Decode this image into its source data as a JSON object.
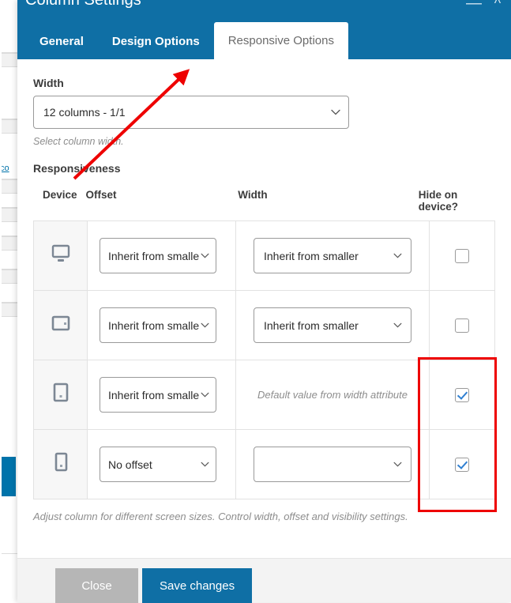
{
  "window": {
    "title": "Column Settings",
    "minimize_label": "—",
    "collapse_label": "^",
    "accent_color": "#0f6fa5",
    "annotation_color": "#ee0000"
  },
  "tabs": [
    {
      "label": "General",
      "active": false
    },
    {
      "label": "Design Options",
      "active": false
    },
    {
      "label": "Responsive Options",
      "active": true
    }
  ],
  "width_field": {
    "label": "Width",
    "value": "12 columns - 1/1",
    "help": "Select column width."
  },
  "responsiveness": {
    "title": "Responsiveness",
    "columns": {
      "device": "Device",
      "offset": "Offset",
      "width": "Width",
      "hide_line1": "Hide on",
      "hide_line2": "device?"
    },
    "rows": [
      {
        "device_icon": "desktop-icon",
        "offset_value": "Inherit from smalle",
        "width_value": "Inherit from smaller",
        "width_is_text": false,
        "hide_checked": false
      },
      {
        "device_icon": "tablet-landscape-icon",
        "offset_value": "Inherit from smalle",
        "width_value": "Inherit from smaller",
        "width_is_text": false,
        "hide_checked": false
      },
      {
        "device_icon": "tablet-portrait-icon",
        "offset_value": "Inherit from smalle",
        "width_value": "Default value from width attribute",
        "width_is_text": true,
        "hide_checked": true
      },
      {
        "device_icon": "mobile-icon",
        "offset_value": "No offset",
        "width_value": "",
        "width_is_text": false,
        "hide_checked": true
      }
    ],
    "footnote": "Adjust column for different screen sizes. Control width, offset and visibility settings."
  },
  "footer": {
    "close_label": "Close",
    "save_label": "Save changes"
  },
  "background_page": {
    "link_text": "co"
  }
}
